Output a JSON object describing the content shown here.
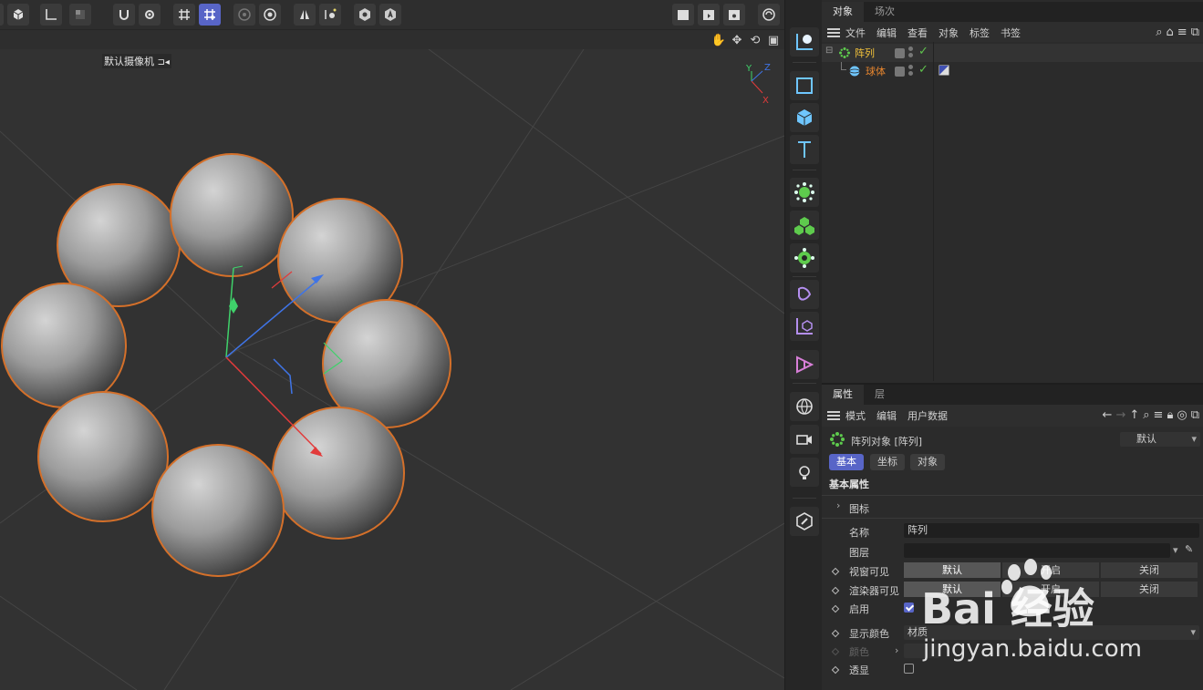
{
  "viewport": {
    "camera_label": "默认摄像机",
    "camera_icon": "camera-link-icon",
    "axis_labels": {
      "y": "Y",
      "z": "Z",
      "x": "X"
    }
  },
  "object_manager": {
    "tabs": [
      "对象",
      "场次"
    ],
    "menu": [
      "文件",
      "编辑",
      "查看",
      "对象",
      "标签",
      "书签"
    ],
    "objects": [
      {
        "name": "阵列",
        "color": "#f0c03a",
        "icon": "cloner-array-icon",
        "visible": true
      },
      {
        "name": "球体",
        "color": "#e8862e",
        "icon": "sphere-icon",
        "visible": true
      }
    ]
  },
  "attribute_manager": {
    "tabs": [
      "属性",
      "层"
    ],
    "menu": [
      "模式",
      "编辑",
      "用户数据"
    ],
    "object_title": "阵列对象 [阵列]",
    "preset": "默认",
    "mode_buttons": [
      "基本",
      "坐标",
      "对象"
    ],
    "section_title": "基本属性",
    "group_icon_label": "图标",
    "name_label": "名称",
    "name_value": "阵列",
    "layer_label": "图层",
    "viewport_visible_label": "视窗可见",
    "render_visible_label": "渲染器可见",
    "enable_label": "启用",
    "display_color_label": "显示颜色",
    "display_color_value": "材质",
    "color_label": "颜色",
    "xray_label": "透显",
    "seg_options": [
      "默认",
      "开启",
      "关闭"
    ],
    "enable_checked": true,
    "xray_checked": false
  },
  "watermark": {
    "text": "Bai  经验",
    "url": "jingyan.baidu.com"
  },
  "colors": {
    "accent": "#5865c7",
    "selection_outline": "#d4702a",
    "check": "#5ec04d"
  }
}
